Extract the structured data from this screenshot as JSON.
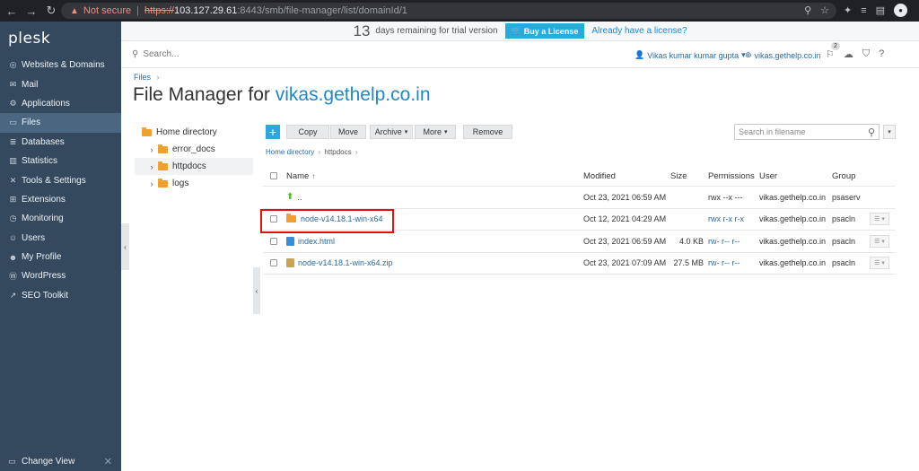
{
  "browser": {
    "security_label": "Not secure",
    "url_scheme": "https://",
    "url_host": "103.127.29.61",
    "url_path": ":8443/smb/file-manager/list/domainId/1"
  },
  "sidebar": {
    "logo": "plesk",
    "items": [
      {
        "label": "Websites & Domains",
        "icon": "globe-icon",
        "active": false
      },
      {
        "label": "Mail",
        "icon": "mail-icon",
        "active": false
      },
      {
        "label": "Applications",
        "icon": "applications-icon",
        "active": false
      },
      {
        "label": "Files",
        "icon": "files-icon",
        "active": true
      },
      {
        "label": "Databases",
        "icon": "database-icon",
        "active": false
      },
      {
        "label": "Statistics",
        "icon": "statistics-icon",
        "active": false
      },
      {
        "label": "Tools & Settings",
        "icon": "tools-icon",
        "active": false
      },
      {
        "label": "Extensions",
        "icon": "extensions-icon",
        "active": false
      },
      {
        "label": "Monitoring",
        "icon": "monitoring-icon",
        "active": false
      },
      {
        "label": "Users",
        "icon": "users-icon",
        "active": false
      },
      {
        "label": "My Profile",
        "icon": "profile-icon",
        "active": false
      },
      {
        "label": "WordPress",
        "icon": "wordpress-icon",
        "active": false
      },
      {
        "label": "SEO Toolkit",
        "icon": "seo-icon",
        "active": false
      }
    ],
    "change_view": "Change View"
  },
  "trial": {
    "days": "13",
    "text": "days remaining for trial version",
    "buy_label": "Buy a License",
    "have_license": "Already have a license?"
  },
  "header": {
    "search_placeholder": "Search...",
    "user": "Vikas kumar kumar gupta",
    "domain": "vikas.gethelp.co.in",
    "notifications_count": "2"
  },
  "page": {
    "breadcrumb": "Files",
    "title_prefix": "File Manager for ",
    "title_domain": "vikas.gethelp.co.in"
  },
  "tree": {
    "root": "Home directory",
    "children": [
      "error_docs",
      "httpdocs",
      "logs"
    ]
  },
  "toolbar": {
    "add_label": "+",
    "copy": "Copy",
    "move": "Move",
    "archive": "Archive",
    "more": "More",
    "remove": "Remove",
    "filter_placeholder": "Search in filename"
  },
  "path": {
    "home": "Home directory",
    "current": "httpdocs"
  },
  "table": {
    "headers": {
      "name": "Name",
      "modified": "Modified",
      "size": "Size",
      "permissions": "Permissions",
      "user": "User",
      "group": "Group"
    },
    "rows": [
      {
        "name": "..",
        "type": "up",
        "modified": "Oct 23, 2021 06:59 AM",
        "size": "",
        "permissions": "rwx --x ---",
        "user": "vikas.gethelp.co.in",
        "group": "psaserv"
      },
      {
        "name": "node-v14.18.1-win-x64",
        "type": "folder",
        "modified": "Oct 12, 2021 04:29 AM",
        "size": "",
        "permissions": "rwx r-x r-x",
        "user": "vikas.gethelp.co.in",
        "group": "psacln"
      },
      {
        "name": "index.html",
        "type": "html",
        "modified": "Oct 23, 2021 06:59 AM",
        "size": "4.0 KB",
        "permissions": "rw- r-- r--",
        "user": "vikas.gethelp.co.in",
        "group": "psacln"
      },
      {
        "name": "node-v14.18.1-win-x64.zip",
        "type": "zip",
        "modified": "Oct 23, 2021 07:09 AM",
        "size": "27.5 MB",
        "permissions": "rw- r-- r--",
        "user": "vikas.gethelp.co.in",
        "group": "psacln"
      }
    ]
  },
  "colors": {
    "sidebar_bg": "#34495e",
    "accent": "#28aade",
    "link": "#2b6aa1",
    "highlight_box": "#e01010"
  }
}
